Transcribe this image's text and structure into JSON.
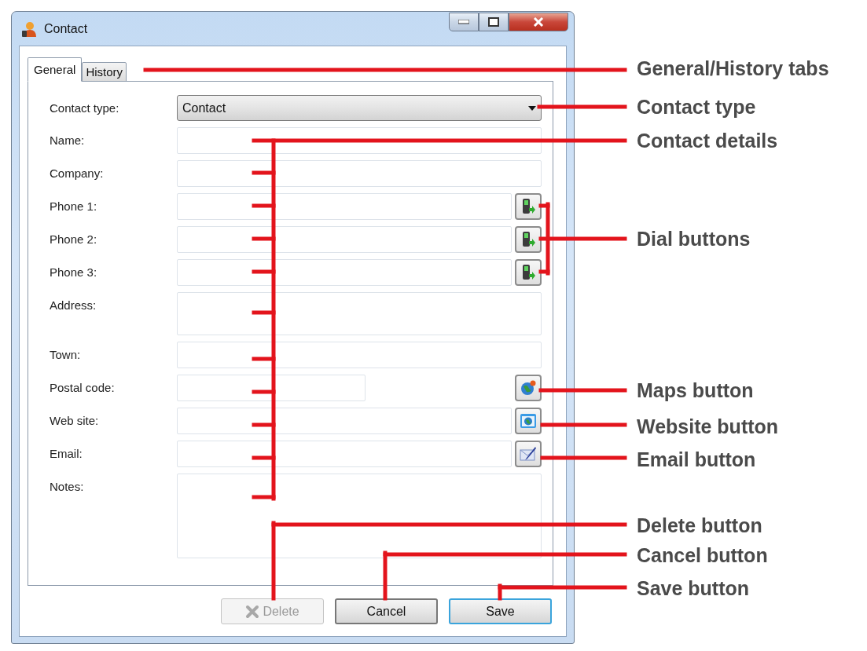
{
  "window": {
    "title": "Contact"
  },
  "tabs": [
    {
      "label": "General",
      "selected": true
    },
    {
      "label": "History",
      "selected": false
    }
  ],
  "fields": [
    {
      "label": "Contact type:",
      "kind": "dropdown",
      "value": "Contact"
    },
    {
      "label": "Name:",
      "kind": "text"
    },
    {
      "label": "Company:",
      "kind": "text"
    },
    {
      "label": "Phone 1:",
      "kind": "text",
      "button": {
        "kind": "dial"
      }
    },
    {
      "label": "Phone 2:",
      "kind": "text",
      "button": {
        "kind": "dial"
      }
    },
    {
      "label": "Phone 3:",
      "kind": "text",
      "button": {
        "kind": "dial"
      }
    },
    {
      "label": "Address:",
      "kind": "multiline"
    },
    {
      "label": "Town:",
      "kind": "text"
    },
    {
      "label": "Postal code:",
      "kind": "short",
      "button": {
        "kind": "maps"
      }
    },
    {
      "label": "Web site:",
      "kind": "text",
      "button": {
        "kind": "website"
      }
    },
    {
      "label": "Email:",
      "kind": "text",
      "button": {
        "kind": "email"
      }
    },
    {
      "label": "Notes:",
      "kind": "notes"
    }
  ],
  "buttons": [
    {
      "label": "Delete",
      "kind": "delete",
      "disabled": true,
      "default": false
    },
    {
      "label": "Cancel",
      "kind": "plain",
      "disabled": false,
      "default": false
    },
    {
      "label": "Save",
      "kind": "plain",
      "disabled": false,
      "default": true
    }
  ],
  "annotations": [
    {
      "label": "General/History tabs"
    },
    {
      "label": "Contact type"
    },
    {
      "label": "Contact details"
    },
    {
      "label": "Dial buttons"
    },
    {
      "label": "Maps button"
    },
    {
      "label": "Website button"
    },
    {
      "label": "Email button"
    },
    {
      "label": "Delete button"
    },
    {
      "label": "Cancel button"
    },
    {
      "label": "Save button"
    }
  ]
}
